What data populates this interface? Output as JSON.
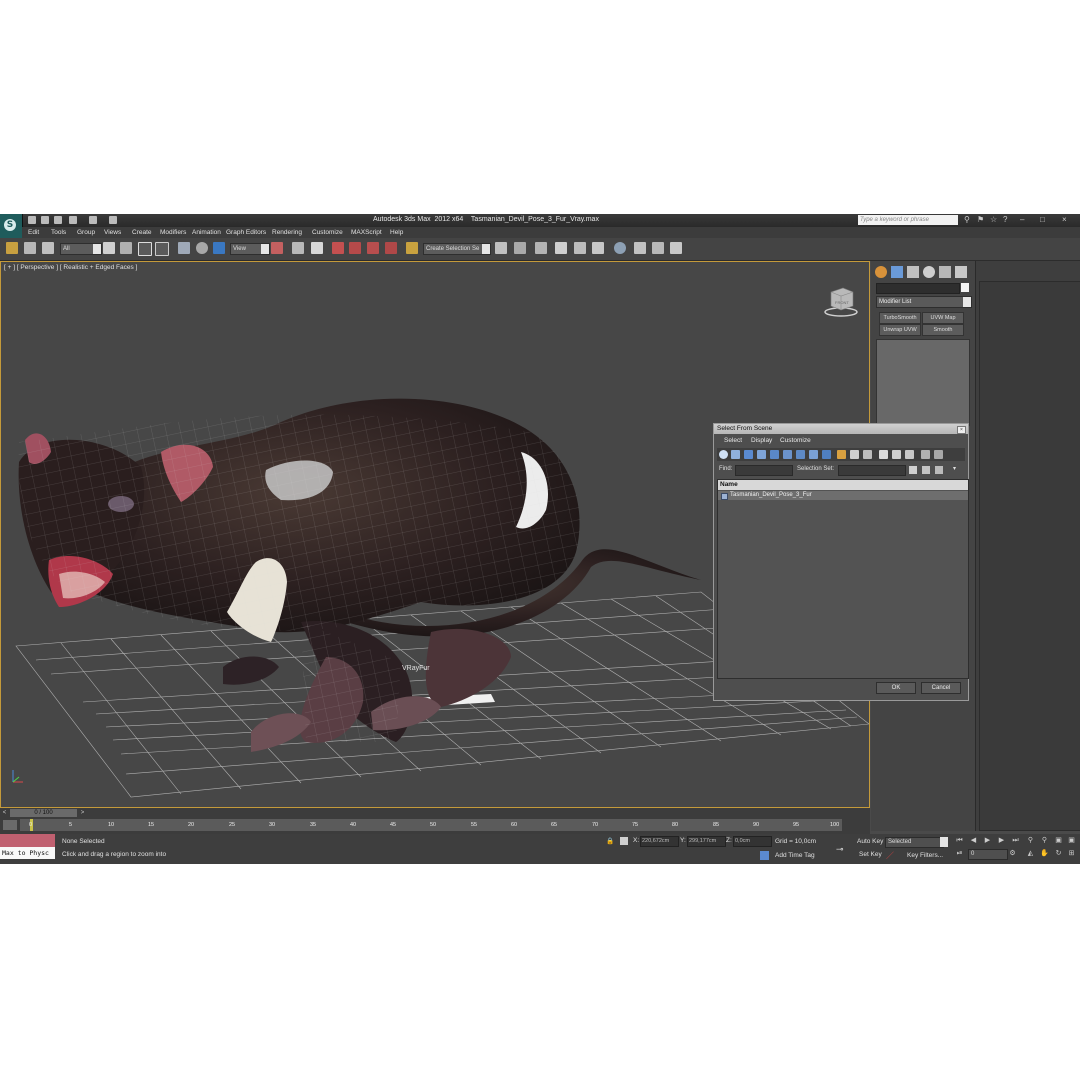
{
  "app": {
    "title": "Autodesk 3ds Max  2012 x64    Tasmanian_Devil_Pose_3_Fur_Vray.max",
    "search_placeholder": "Type a keyword or phrase",
    "logo_letter": "S"
  },
  "menu": [
    "Edit",
    "Tools",
    "Group",
    "Views",
    "Create",
    "Modifiers",
    "Animation",
    "Graph Editors",
    "Rendering",
    "Customize",
    "MAXScript",
    "Help"
  ],
  "toolbar": {
    "filter": "All",
    "ref_coord": "View",
    "selection_set": "Create Selection Se"
  },
  "viewport": {
    "label": "[ + ] [ Perspective ] [ Realistic + Edged Faces ]",
    "viewcube_label": "FRONT",
    "light_label": "VRayFur"
  },
  "command_panel": {
    "modifier_list": "Modifier List",
    "buttons": [
      "TurboSmooth",
      "UVW Map",
      "Unwrap UVW",
      "Smooth"
    ]
  },
  "dialog": {
    "title": "Select From Scene",
    "menu": [
      "Select",
      "Display",
      "Customize"
    ],
    "find_label": "Find:",
    "selection_set_label": "Selection Set:",
    "column": "Name",
    "rows": [
      "Tasmanian_Devil_Pose_3_Fur"
    ],
    "ok": "OK",
    "cancel": "Cancel"
  },
  "timeline": {
    "frame": "0 / 100",
    "ticks": [
      "0",
      "5",
      "10",
      "15",
      "20",
      "25",
      "30",
      "35",
      "40",
      "45",
      "50",
      "55",
      "60",
      "65",
      "70",
      "75",
      "80",
      "85",
      "90",
      "95",
      "100"
    ]
  },
  "status": {
    "maxscript": "Max to Physc",
    "selection": "None Selected",
    "prompt": "Click and drag a region to zoom into",
    "x_label": "X:",
    "x": "220,672cm",
    "y_label": "Y:",
    "y": "299,177cm",
    "z_label": "Z:",
    "z": "0,0cm",
    "grid": "Grid = 10,0cm",
    "add_time_tag": "Add Time Tag",
    "auto_key": "Auto Key",
    "set_key": "Set Key",
    "key_mode": "Selected",
    "key_filters": "Key Filters...",
    "frame_field": "0"
  }
}
